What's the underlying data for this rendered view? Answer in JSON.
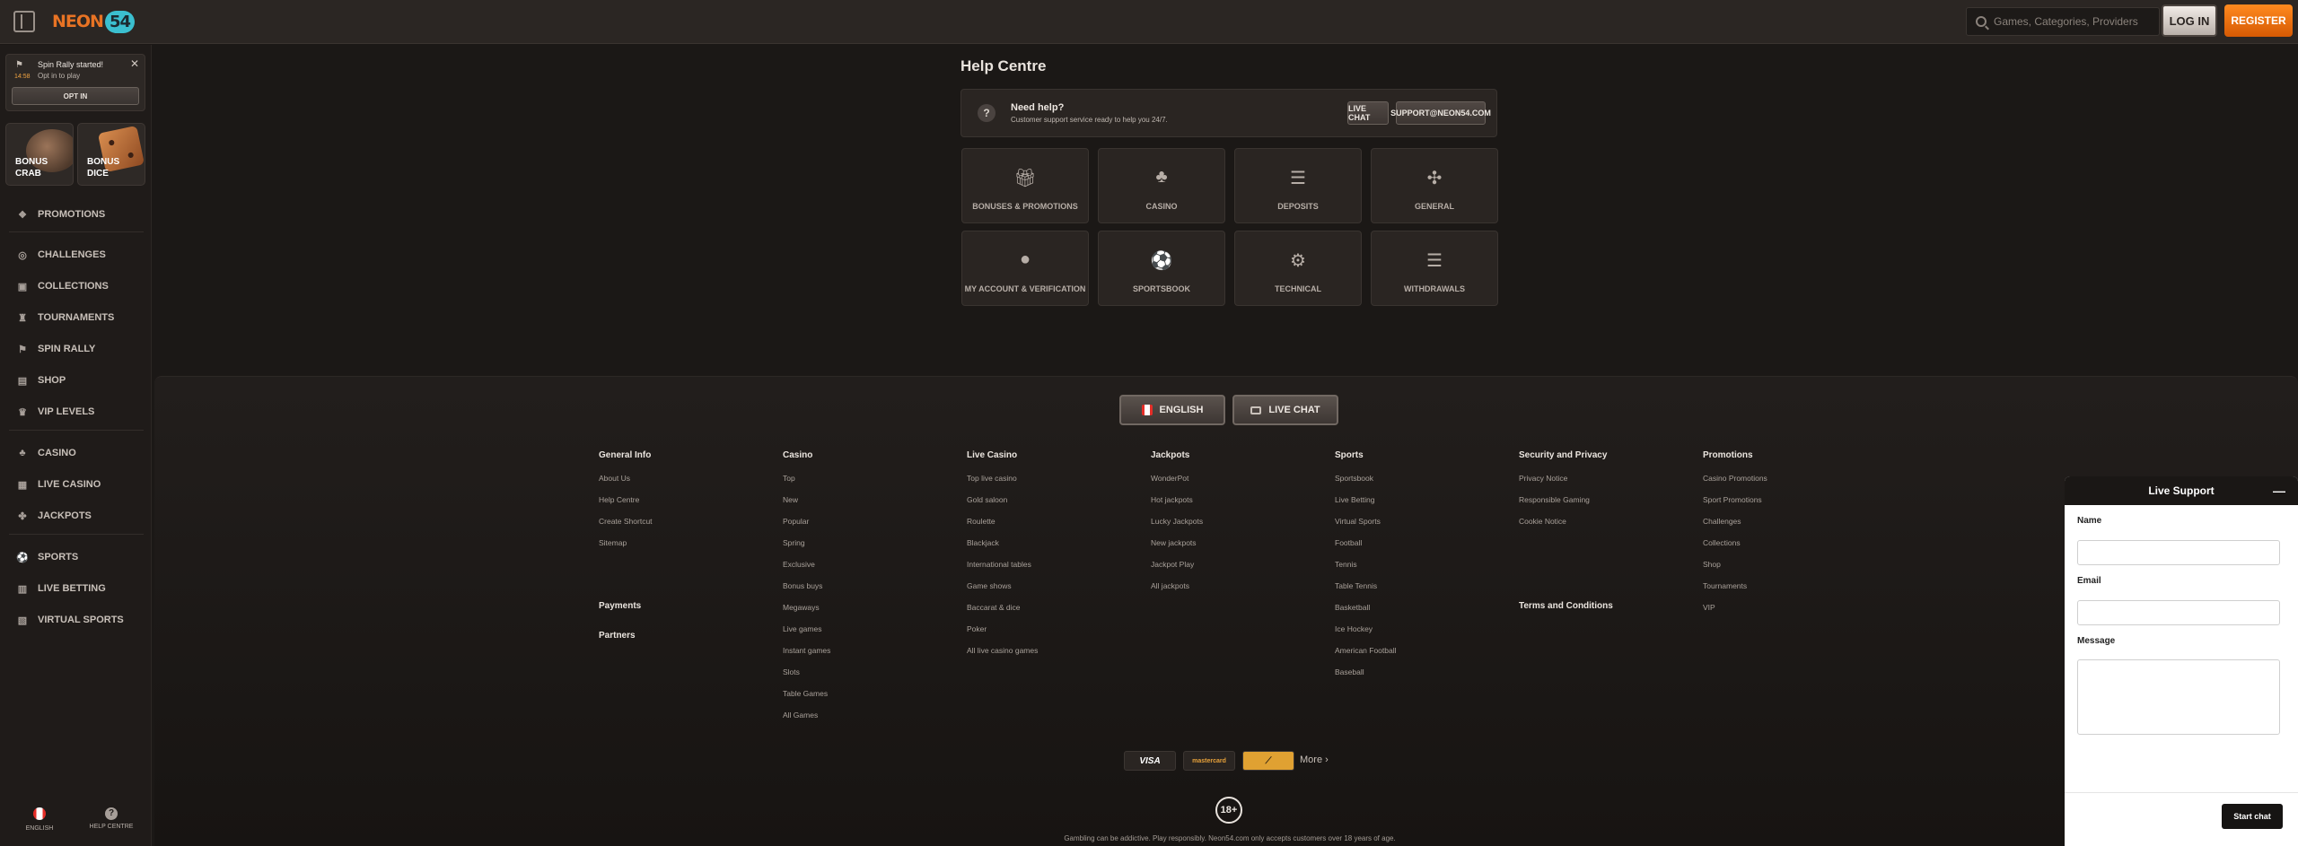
{
  "header": {
    "logo_text": "NEON",
    "logo_number": "54",
    "search_placeholder": "Games, Categories, Providers",
    "login_label": "LOG IN",
    "register_label": "REGISTER"
  },
  "notification": {
    "title": "Spin Rally started!",
    "subtitle": "Opt in to play",
    "timer": "14:58",
    "optin_label": "OPT IN",
    "close": "✕"
  },
  "bonus_tiles": [
    {
      "label": "BONUS CRAB"
    },
    {
      "label": "BONUS DICE"
    }
  ],
  "sidebar": {
    "group1": [
      {
        "label": "PROMOTIONS",
        "icon": "gift-icon"
      }
    ],
    "group2": [
      {
        "label": "CHALLENGES",
        "icon": "target-icon"
      },
      {
        "label": "COLLECTIONS",
        "icon": "collection-icon"
      },
      {
        "label": "TOURNAMENTS",
        "icon": "trophy-icon"
      },
      {
        "label": "SPIN RALLY",
        "icon": "flag-icon"
      },
      {
        "label": "SHOP",
        "icon": "shop-icon"
      },
      {
        "label": "VIP LEVELS",
        "icon": "crown-icon"
      }
    ],
    "group3": [
      {
        "label": "CASINO",
        "icon": "cards-icon"
      },
      {
        "label": "LIVE CASINO",
        "icon": "live-casino-icon"
      },
      {
        "label": "JACKPOTS",
        "icon": "jackpot-icon"
      }
    ],
    "group4": [
      {
        "label": "SPORTS",
        "icon": "ball-icon"
      },
      {
        "label": "LIVE BETTING",
        "icon": "live-betting-icon"
      },
      {
        "label": "VIRTUAL SPORTS",
        "icon": "virtual-sports-icon"
      }
    ],
    "footer": {
      "language": "ENGLISH",
      "help": "HELP CENTRE"
    }
  },
  "main": {
    "title": "Help Centre",
    "banner": {
      "title": "Need help?",
      "subtitle": "Customer support service ready to help you 24/7.",
      "live_chat": "LIVE CHAT",
      "email": "SUPPORT@NEON54.COM"
    },
    "categories": [
      {
        "label": "BONUSES & PROMOTIONS",
        "icon": "gift-icon"
      },
      {
        "label": "CASINO",
        "icon": "casino-chips-icon"
      },
      {
        "label": "DEPOSITS",
        "icon": "coins-icon"
      },
      {
        "label": "GENERAL",
        "icon": "dice-icon"
      },
      {
        "label": "MY ACCOUNT & VERIFICATION",
        "icon": "user-icon"
      },
      {
        "label": "SPORTSBOOK",
        "icon": "soccer-ball-icon"
      },
      {
        "label": "TECHNICAL",
        "icon": "gear-icon"
      },
      {
        "label": "WITHDRAWALS",
        "icon": "coins-icon"
      }
    ]
  },
  "footer": {
    "language_button": "ENGLISH",
    "chat_button": "LIVE CHAT",
    "columns": [
      {
        "heading": "General Info",
        "links": [
          "About Us",
          "Help Centre",
          "Create Shortcut",
          "Sitemap"
        ]
      },
      {
        "heading": "Casino",
        "links": [
          "Top",
          "New",
          "Popular",
          "Spring",
          "Exclusive",
          "Bonus buys",
          "Megaways",
          "Live games",
          "Instant games",
          "Slots",
          "Table Games",
          "All Games"
        ]
      },
      {
        "heading": "Live Casino",
        "links": [
          "Top live casino",
          "Gold saloon",
          "Roulette",
          "Blackjack",
          "International tables",
          "Game shows",
          "Baccarat & dice",
          "Poker",
          "All live casino games"
        ]
      },
      {
        "heading": "Jackpots",
        "links": [
          "WonderPot",
          "Hot jackpots",
          "Lucky Jackpots",
          "New jackpots",
          "Jackpot Play",
          "All jackpots"
        ]
      },
      {
        "heading": "Sports",
        "links": [
          "Sportsbook",
          "Live Betting",
          "Virtual Sports",
          "Football",
          "Tennis",
          "Table Tennis",
          "Basketball",
          "Ice Hockey",
          "American Football",
          "Baseball"
        ]
      },
      {
        "heading": "Security and Privacy",
        "links": [
          "Privacy Notice",
          "Responsible Gaming",
          "Cookie Notice"
        ]
      },
      {
        "heading": "Promotions",
        "links": [
          "Casino Promotions",
          "Sport Promotions",
          "Challenges",
          "Collections",
          "Shop",
          "Tournaments",
          "VIP"
        ]
      }
    ],
    "extra_headings": {
      "payments": "Payments",
      "partners": "Partners",
      "terms": "Terms and Conditions"
    },
    "payments": [
      "VISA",
      "mastercard",
      "⟋"
    ],
    "more": "More",
    "age": "18+",
    "disclaimer": "Gambling can be addictive. Play responsibly. Neon54.com only accepts customers over 18 years of age."
  },
  "live_support": {
    "title": "Live Support",
    "minimize": "—",
    "name_label": "Name",
    "email_label": "Email",
    "message_label": "Message",
    "start_button": "Start chat"
  },
  "colors": {
    "accent": "#e87324",
    "background": "#1b1816",
    "panel": "#2a2522"
  }
}
